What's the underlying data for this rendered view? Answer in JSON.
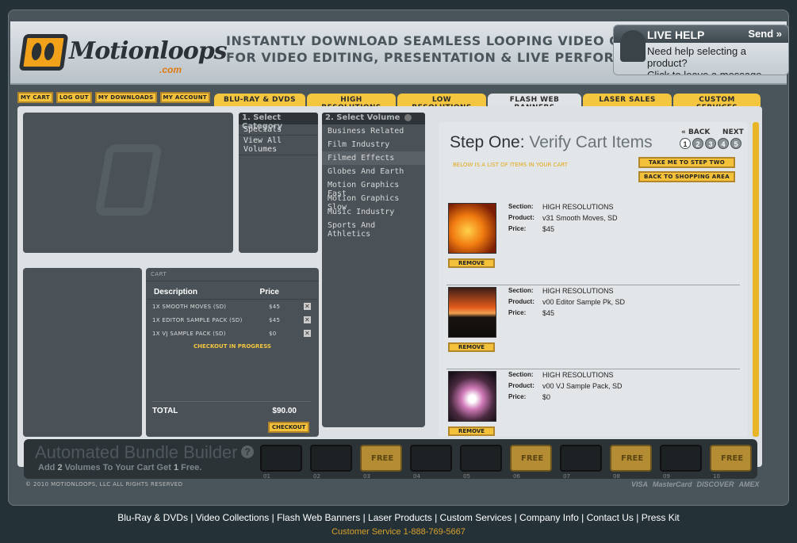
{
  "brand": {
    "name": "Motionloops",
    "domain": ".com"
  },
  "tagline": [
    "INSTANTLY DOWNLOAD SEAMLESS LOOPING VIDEO CLIPS",
    "FOR VIDEO EDITING, PRESENTATION & LIVE PERFORMANCE"
  ],
  "livehelp": {
    "title": "LIVE HELP",
    "send": "Send »",
    "line1": "Need help selecting a product?",
    "line2": "Click to leave a message."
  },
  "account_links": [
    "MY CART",
    "LOG OUT",
    "MY DOWNLOADS",
    "MY ACCOUNT"
  ],
  "tabs": [
    "BLU-RAY & DVDS",
    "HIGH RESOLUTIONS",
    "LOW RESOLUTIONS",
    "FLASH WEB BANNERS",
    "LASER SALES",
    "CUSTOM SERVICES"
  ],
  "active_tab": "FLASH WEB BANNERS",
  "category": {
    "heading": "1. Select Category",
    "items": [
      "Specials",
      "View All Volumes"
    ]
  },
  "volume": {
    "heading": "2. Select Volume",
    "items": [
      "Business Related",
      "Film Industry",
      "Filmed Effects",
      "Globes And Earth",
      "Motion Graphics Fast",
      "Motion Graphics Slow",
      "Music Industry",
      "Sports And Athletics"
    ],
    "active": "Filmed Effects"
  },
  "cart": {
    "heading": "CART",
    "col_desc": "Description",
    "col_price": "Price",
    "rows": [
      {
        "desc": "1X SMOOTH MOVES (SD)",
        "price": "$45"
      },
      {
        "desc": "1X EDITOR SAMPLE PACK (SD)",
        "price": "$45"
      },
      {
        "desc": "1X VJ SAMPLE PACK (SD)",
        "price": "$0"
      }
    ],
    "status": "CHECKOUT IN PROGRESS",
    "total_label": "TOTAL",
    "total_value": "$90.00",
    "checkout_label": "CHECKOUT"
  },
  "step": {
    "prefix": "Step One:",
    "title": "Verify Cart Items",
    "back": "« BACK",
    "next": "NEXT »",
    "numbers": [
      "1",
      "2",
      "3",
      "4",
      "5"
    ],
    "note": "BELOW IS A LIST OF ITEMS IN YOUR CART",
    "btn_step2": "TAKE ME TO STEP TWO",
    "btn_back_shop": "BACK TO SHOPPING AREA"
  },
  "labels": {
    "section": "Section:",
    "product": "Product:",
    "price": "Price:",
    "remove": "REMOVE"
  },
  "items": [
    {
      "section": "HIGH RESOLUTIONS",
      "product": "v31 Smooth Moves, SD",
      "price": "$45"
    },
    {
      "section": "HIGH RESOLUTIONS",
      "product": "v00 Editor Sample Pk, SD",
      "price": "$45"
    },
    {
      "section": "HIGH RESOLUTIONS",
      "product": "v00 VJ Sample Pack, SD",
      "price": "$0"
    }
  ],
  "bundle": {
    "title": "Automated Bundle Builder",
    "sub_pre": "Add ",
    "sub_n1": "2",
    "sub_mid": " Volumes To Your Cart Get ",
    "sub_n2": "1",
    "sub_post": " Free.",
    "help": "?",
    "free_label": "FREE",
    "slots": [
      "01",
      "02",
      "03",
      "04",
      "05",
      "06",
      "07",
      "08",
      "09",
      "10"
    ],
    "free_slots": [
      "03",
      "06",
      "08",
      "10"
    ]
  },
  "copyright": "© 2010 MOTIONLOOPS, LLC   ALL RIGHTS RESERVED",
  "cards": [
    "VISA",
    "MasterCard",
    "DISCOVER",
    "AMEX"
  ],
  "footer_links": [
    "Blu-Ray & DVDs",
    "Video Collections",
    "Flash Web Banners",
    "Laser Products",
    "Custom Services",
    "Company Info",
    "Contact Us",
    "Press Kit"
  ],
  "customer_service": "Customer Service 1-888-769-5667"
}
